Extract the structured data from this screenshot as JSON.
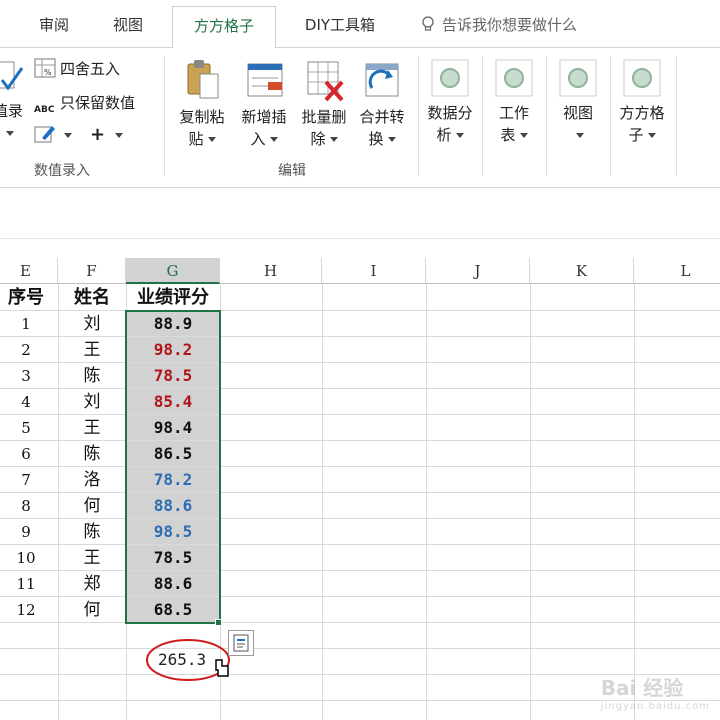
{
  "tabs": [
    {
      "label": "审阅",
      "active": false
    },
    {
      "label": "视图",
      "active": false
    },
    {
      "label": "方方格子",
      "active": true
    },
    {
      "label": "DIY工具箱",
      "active": false
    }
  ],
  "tell_me": "告诉我你想要做什么",
  "ribbon": {
    "group_value_entry": {
      "label": "数值录入",
      "partial_button": "值录",
      "round": "四舍五入",
      "keep_values": "只保留数值",
      "plus": "+"
    },
    "group_edit": {
      "label": "编辑",
      "buttons": [
        {
          "line1": "复制粘",
          "line2": "贴"
        },
        {
          "line1": "新增插",
          "line2": "入"
        },
        {
          "line1": "批量删",
          "line2": "除"
        },
        {
          "line1": "合并转",
          "line2": "换"
        }
      ]
    },
    "right_buttons": [
      {
        "line1": "数据分",
        "line2": "析"
      },
      {
        "line1": "工作",
        "line2": "表"
      },
      {
        "line1": "视图",
        "line2": ""
      },
      {
        "line1": "方方格",
        "line2": "子"
      }
    ]
  },
  "sheet": {
    "columns": [
      "E",
      "F",
      "G",
      "H",
      "I",
      "J",
      "K",
      "L"
    ],
    "selected_column": "G",
    "headers": {
      "seq": "序号",
      "name": "姓名",
      "score": "业绩评分"
    },
    "rows": [
      {
        "seq": "1",
        "name": "刘",
        "score": "88.9",
        "color": "#111111"
      },
      {
        "seq": "2",
        "name": "王",
        "score": "98.2",
        "color": "#b0151a"
      },
      {
        "seq": "3",
        "name": "陈",
        "score": "78.5",
        "color": "#b0151a"
      },
      {
        "seq": "4",
        "name": "刘",
        "score": "85.4",
        "color": "#b0151a"
      },
      {
        "seq": "5",
        "name": "王",
        "score": "98.4",
        "color": "#111111"
      },
      {
        "seq": "6",
        "name": "陈",
        "score": "86.5",
        "color": "#111111"
      },
      {
        "seq": "7",
        "name": "洛",
        "score": "78.2",
        "color": "#2e6db4"
      },
      {
        "seq": "8",
        "name": "何",
        "score": "88.6",
        "color": "#2e6db4"
      },
      {
        "seq": "9",
        "name": "陈",
        "score": "98.5",
        "color": "#2e6db4"
      },
      {
        "seq": "10",
        "name": "王",
        "score": "78.5",
        "color": "#111111"
      },
      {
        "seq": "11",
        "name": "郑",
        "score": "88.6",
        "color": "#111111"
      },
      {
        "seq": "12",
        "name": "何",
        "score": "68.5",
        "color": "#111111"
      }
    ],
    "sum_value": "265.3"
  },
  "colors": {
    "accent": "#217346",
    "selection_fill": "#d2d2d2",
    "annotation_circle": "#d01919"
  },
  "watermark": {
    "brand": "Bai 经验",
    "url": "jingyan.baidu.com"
  }
}
